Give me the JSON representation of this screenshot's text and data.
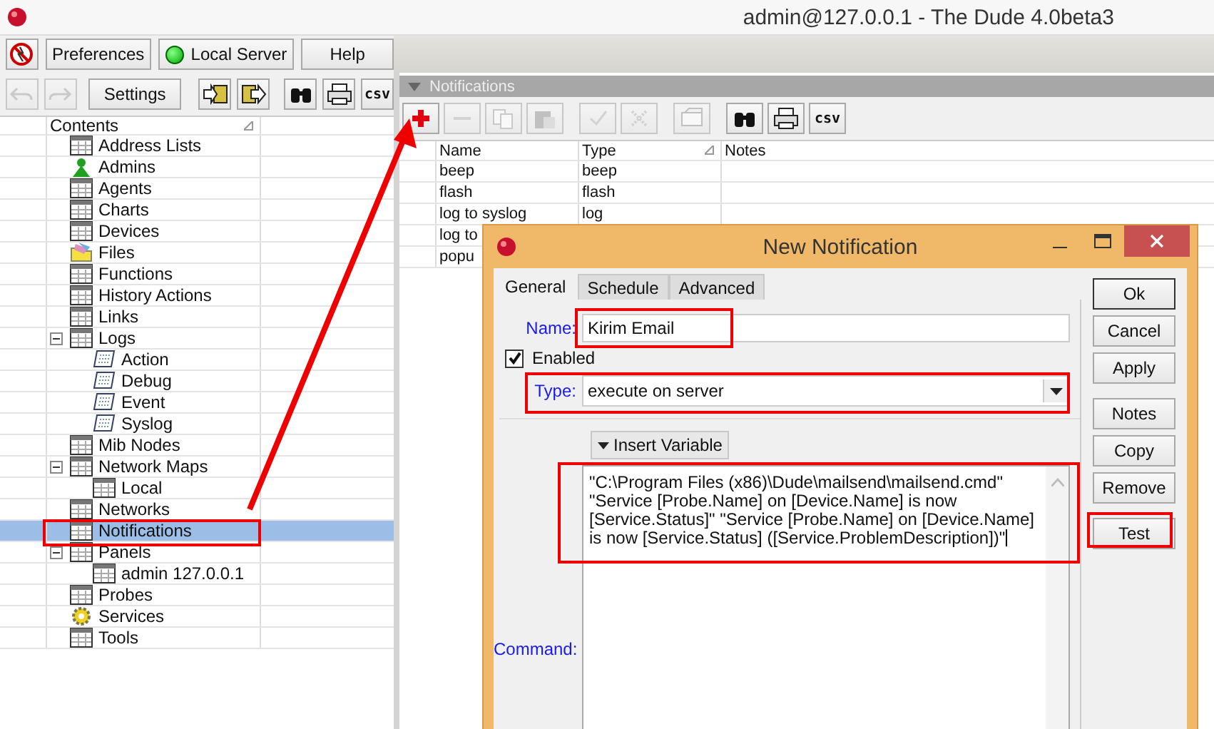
{
  "window": {
    "title": "admin@127.0.0.1 - The Dude 4.0beta3"
  },
  "main_toolbar": [
    {
      "kind": "stop"
    },
    {
      "kind": "text",
      "label": "Preferences"
    },
    {
      "kind": "server",
      "label": "Local Server"
    },
    {
      "kind": "text",
      "label": "Help"
    }
  ],
  "left_toolbar": [
    {
      "kind": "undo",
      "disabled": true
    },
    {
      "kind": "redo",
      "disabled": true
    },
    {
      "kind": "text",
      "label": "Settings",
      "disabled": false
    },
    {
      "kind": "import",
      "disabled": false
    },
    {
      "kind": "export",
      "disabled": false
    },
    {
      "kind": "find",
      "disabled": false
    },
    {
      "kind": "print",
      "disabled": false
    },
    {
      "kind": "csv",
      "label": "csv",
      "disabled": false
    }
  ],
  "tree": {
    "column": {
      "label": "Contents",
      "sorted": true
    },
    "items": [
      {
        "label": "Address Lists",
        "kind": "table",
        "selected": false
      },
      {
        "label": "Admins",
        "kind": "user",
        "selected": false
      },
      {
        "label": "Agents",
        "kind": "table",
        "selected": false
      },
      {
        "label": "Charts",
        "kind": "table",
        "selected": false
      },
      {
        "label": "Devices",
        "kind": "table",
        "selected": false
      },
      {
        "label": "Files",
        "kind": "files",
        "selected": false
      },
      {
        "label": "Functions",
        "kind": "table",
        "selected": false
      },
      {
        "label": "History Actions",
        "kind": "table",
        "selected": false
      },
      {
        "label": "Links",
        "kind": "table",
        "selected": false
      },
      {
        "label": "Logs",
        "kind": "table",
        "selected": false,
        "expanded": true,
        "children": [
          {
            "label": "Action",
            "kind": "log",
            "selected": false
          },
          {
            "label": "Debug",
            "kind": "log",
            "selected": false
          },
          {
            "label": "Event",
            "kind": "log",
            "selected": false
          },
          {
            "label": "Syslog",
            "kind": "log",
            "selected": false
          }
        ]
      },
      {
        "label": "Mib Nodes",
        "kind": "table",
        "selected": false
      },
      {
        "label": "Network Maps",
        "kind": "table",
        "selected": false,
        "expanded": true,
        "children": [
          {
            "label": "Local",
            "kind": "table",
            "selected": false
          }
        ]
      },
      {
        "label": "Networks",
        "kind": "table",
        "selected": false
      },
      {
        "label": "Notifications",
        "kind": "table",
        "selected": true
      },
      {
        "label": "Panels",
        "kind": "table",
        "selected": false,
        "expanded": true,
        "children": [
          {
            "label": "admin 127.0.0.1",
            "kind": "table",
            "selected": false
          }
        ]
      },
      {
        "label": "Probes",
        "kind": "table",
        "selected": false
      },
      {
        "label": "Services",
        "kind": "gear",
        "selected": false
      },
      {
        "label": "Tools",
        "kind": "table",
        "selected": false
      }
    ]
  },
  "panel": {
    "title": "Notifications",
    "toolbar": [
      {
        "kind": "add",
        "disabled": false
      },
      {
        "kind": "remove",
        "disabled": true
      },
      {
        "kind": "copy",
        "disabled": true
      },
      {
        "kind": "paste",
        "disabled": true
      },
      {
        "kind": "enable",
        "disabled": true
      },
      {
        "kind": "disable",
        "disabled": true
      },
      {
        "kind": "comment",
        "disabled": true
      },
      {
        "kind": "find",
        "disabled": false
      },
      {
        "kind": "print",
        "disabled": false
      },
      {
        "kind": "csv",
        "label": "csv",
        "disabled": false
      }
    ],
    "table": {
      "columns": [
        {
          "label": "Name",
          "sorted": false
        },
        {
          "label": "Type",
          "sorted": true
        },
        {
          "label": "Notes",
          "sorted": false
        }
      ],
      "rows": [
        [
          "beep",
          "beep"
        ],
        [
          "flash",
          "flash"
        ],
        [
          "log to syslog",
          "log"
        ],
        [
          "log to"
        ],
        [
          "popu"
        ]
      ]
    }
  },
  "dialog": {
    "title": "New Notification",
    "tabs": [
      {
        "label": "General",
        "selected": true
      },
      {
        "label": "Schedule",
        "selected": false
      },
      {
        "label": "Advanced",
        "selected": false
      }
    ],
    "name": {
      "label": "Name:",
      "value": "Kirim Email"
    },
    "enabled": {
      "label": "Enabled",
      "checked": true
    },
    "type": {
      "label": "Type:",
      "value": "execute on server"
    },
    "insert_variable": "Insert Variable",
    "command": {
      "label": "Command:",
      "value": "\"C:\\Program Files (x86)\\Dude\\mailsend\\mailsend.cmd\" \"Service [Probe.Name] on [Device.Name] is now [Service.Status]\" \"Service [Probe.Name] on [Device.Name] is now [Service.Status] ([Service.ProblemDescription])\""
    },
    "buttons": [
      {
        "label": "Ok",
        "default": true
      },
      {
        "label": "Cancel",
        "default": false
      },
      {
        "label": "Apply",
        "default": false
      },
      {
        "label": "Notes",
        "default": false
      },
      {
        "label": "Copy",
        "default": false
      },
      {
        "label": "Remove",
        "default": false
      },
      {
        "label": "Test",
        "default": false
      }
    ]
  }
}
